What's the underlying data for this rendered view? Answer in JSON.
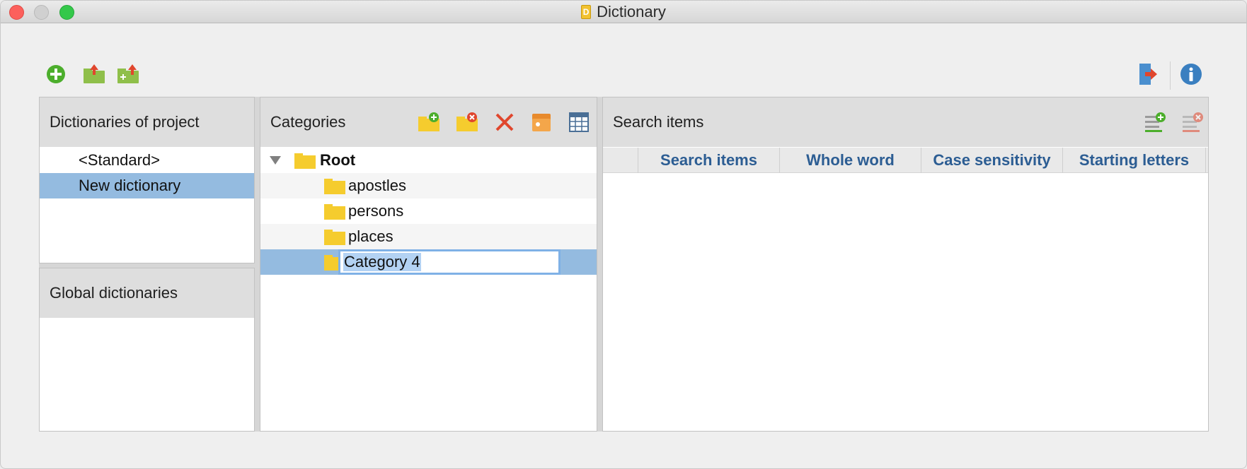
{
  "window": {
    "title": "Dictionary"
  },
  "toolbar": {
    "icons": [
      "add-icon",
      "export-dictionary-icon",
      "import-dictionary-icon",
      "exit-icon",
      "info-icon"
    ]
  },
  "dictionaries_panel": {
    "header": "Dictionaries of project",
    "items": [
      {
        "label": "<Standard>",
        "selected": false
      },
      {
        "label": "New dictionary",
        "selected": true
      }
    ]
  },
  "global_panel": {
    "header": "Global dictionaries",
    "items": []
  },
  "categories_panel": {
    "header": "Categories",
    "tree": {
      "root": "Root",
      "children": [
        {
          "label": "apostles"
        },
        {
          "label": "persons"
        },
        {
          "label": "places"
        }
      ],
      "editing": {
        "value": "Category 4"
      }
    }
  },
  "search_panel": {
    "header": "Search items",
    "columns": [
      "",
      "Search items",
      "Whole word",
      "Case sensitivity",
      "Starting letters"
    ],
    "rows": []
  },
  "colors": {
    "selection": "#94bbe0",
    "column_header_text": "#2c5d93",
    "accent_green": "#4cae2c",
    "accent_red": "#e0462d"
  }
}
